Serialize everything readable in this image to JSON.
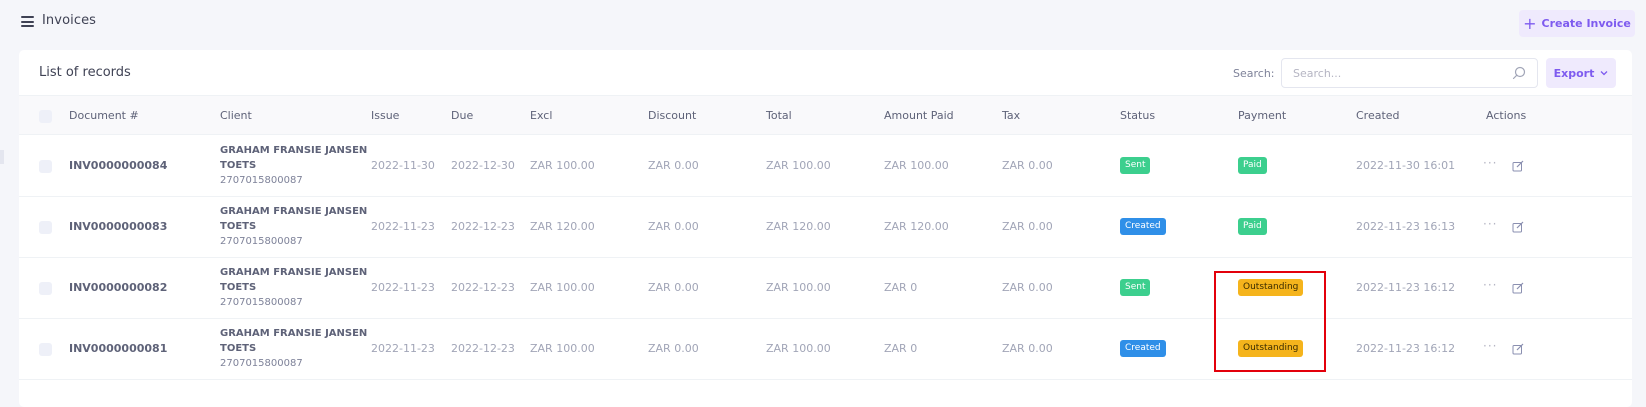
{
  "header": {
    "title": "Invoices",
    "create_label": "Create Invoice"
  },
  "card": {
    "title": "List of records",
    "search_label": "Search:",
    "search_placeholder": "Search...",
    "search_value": "",
    "export_label": "Export"
  },
  "columns": [
    "Document #",
    "Client",
    "Issue",
    "Due",
    "Excl",
    "Discount",
    "Total",
    "Amount Paid",
    "Tax",
    "Status",
    "Payment",
    "Created",
    "Actions"
  ],
  "rows": [
    {
      "doc": "INV0000000084",
      "client_name": "GRAHAM FRANSIE JANSEN",
      "client_name2": "TOETS",
      "client_id": "2707015800087",
      "issue": "2022-11-30",
      "due": "2022-12-30",
      "excl": "ZAR 100.00",
      "discount": "ZAR 0.00",
      "total": "ZAR 100.00",
      "amount_paid": "ZAR 100.00",
      "tax": "ZAR 0.00",
      "status": "Sent",
      "payment": "Paid",
      "created": "2022-11-30 16:01"
    },
    {
      "doc": "INV0000000083",
      "client_name": "GRAHAM FRANSIE JANSEN",
      "client_name2": "TOETS",
      "client_id": "2707015800087",
      "issue": "2022-11-23",
      "due": "2022-12-23",
      "excl": "ZAR 120.00",
      "discount": "ZAR 0.00",
      "total": "ZAR 120.00",
      "amount_paid": "ZAR 120.00",
      "tax": "ZAR 0.00",
      "status": "Created",
      "payment": "Paid",
      "created": "2022-11-23 16:13"
    },
    {
      "doc": "INV0000000082",
      "client_name": "GRAHAM FRANSIE JANSEN",
      "client_name2": "TOETS",
      "client_id": "2707015800087",
      "issue": "2022-11-23",
      "due": "2022-12-23",
      "excl": "ZAR 100.00",
      "discount": "ZAR 0.00",
      "total": "ZAR 100.00",
      "amount_paid": "ZAR 0",
      "tax": "ZAR 0.00",
      "status": "Sent",
      "payment": "Outstanding",
      "created": "2022-11-23 16:12"
    },
    {
      "doc": "INV0000000081",
      "client_name": "GRAHAM FRANSIE JANSEN",
      "client_name2": "TOETS",
      "client_id": "2707015800087",
      "issue": "2022-11-23",
      "due": "2022-12-23",
      "excl": "ZAR 100.00",
      "discount": "ZAR 0.00",
      "total": "ZAR 100.00",
      "amount_paid": "ZAR 0",
      "tax": "ZAR 0.00",
      "status": "Created",
      "payment": "Outstanding",
      "created": "2022-11-23 16:12"
    }
  ],
  "row_actions": {
    "more_icon": "ellipsis-icon",
    "edit_icon": "edit-icon"
  },
  "colors": {
    "accent": "#7e5bef",
    "sent": "#3ccf8e",
    "created": "#2f8fe8",
    "paid": "#3ccf8e",
    "outstanding": "#f5b41c",
    "highlight": "#e3000b"
  }
}
